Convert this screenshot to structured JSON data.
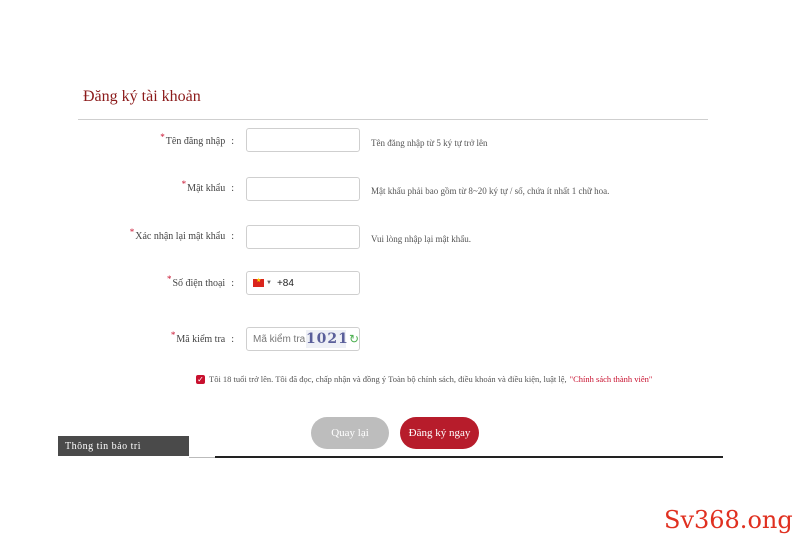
{
  "form": {
    "title": "Đăng ký tài khoản",
    "username": {
      "label": "Tên đăng nhập",
      "value": "",
      "hint": "Tên đăng nhập từ 5 ký tự trở lên"
    },
    "password": {
      "label": "Mật khẩu",
      "value": "",
      "hint": "Mật khẩu phải bao gồm từ 8~20 ký tự / số, chứa ít nhất 1 chữ hoa."
    },
    "confirm_password": {
      "label": "Xác nhận lại mật khẩu",
      "value": "",
      "hint": "Vui lòng nhập lại mật khẩu."
    },
    "phone": {
      "label": "Số điện thoại",
      "country": "VN",
      "dial_code": "+84",
      "value": ""
    },
    "captcha": {
      "label": "Mã kiểm tra",
      "placeholder": "Mã kiểm tra",
      "code": "1021"
    },
    "agreement": {
      "checked": true,
      "text": "Tôi 18 tuổi trở lên. Tôi đã đọc, chấp nhận và đồng ý Toàn bộ chính sách, điều khoản và điều kiện, luật lệ,",
      "link": "\"Chính sách thành viên\""
    },
    "buttons": {
      "back": "Quay lại",
      "submit": "Đăng ký ngay"
    }
  },
  "maintenance_tab": "Thông tin bảo trì",
  "watermark": "Sv368.ong",
  "colors": {
    "brand": "#b71c2b",
    "back_button": "#bdbdbd"
  }
}
